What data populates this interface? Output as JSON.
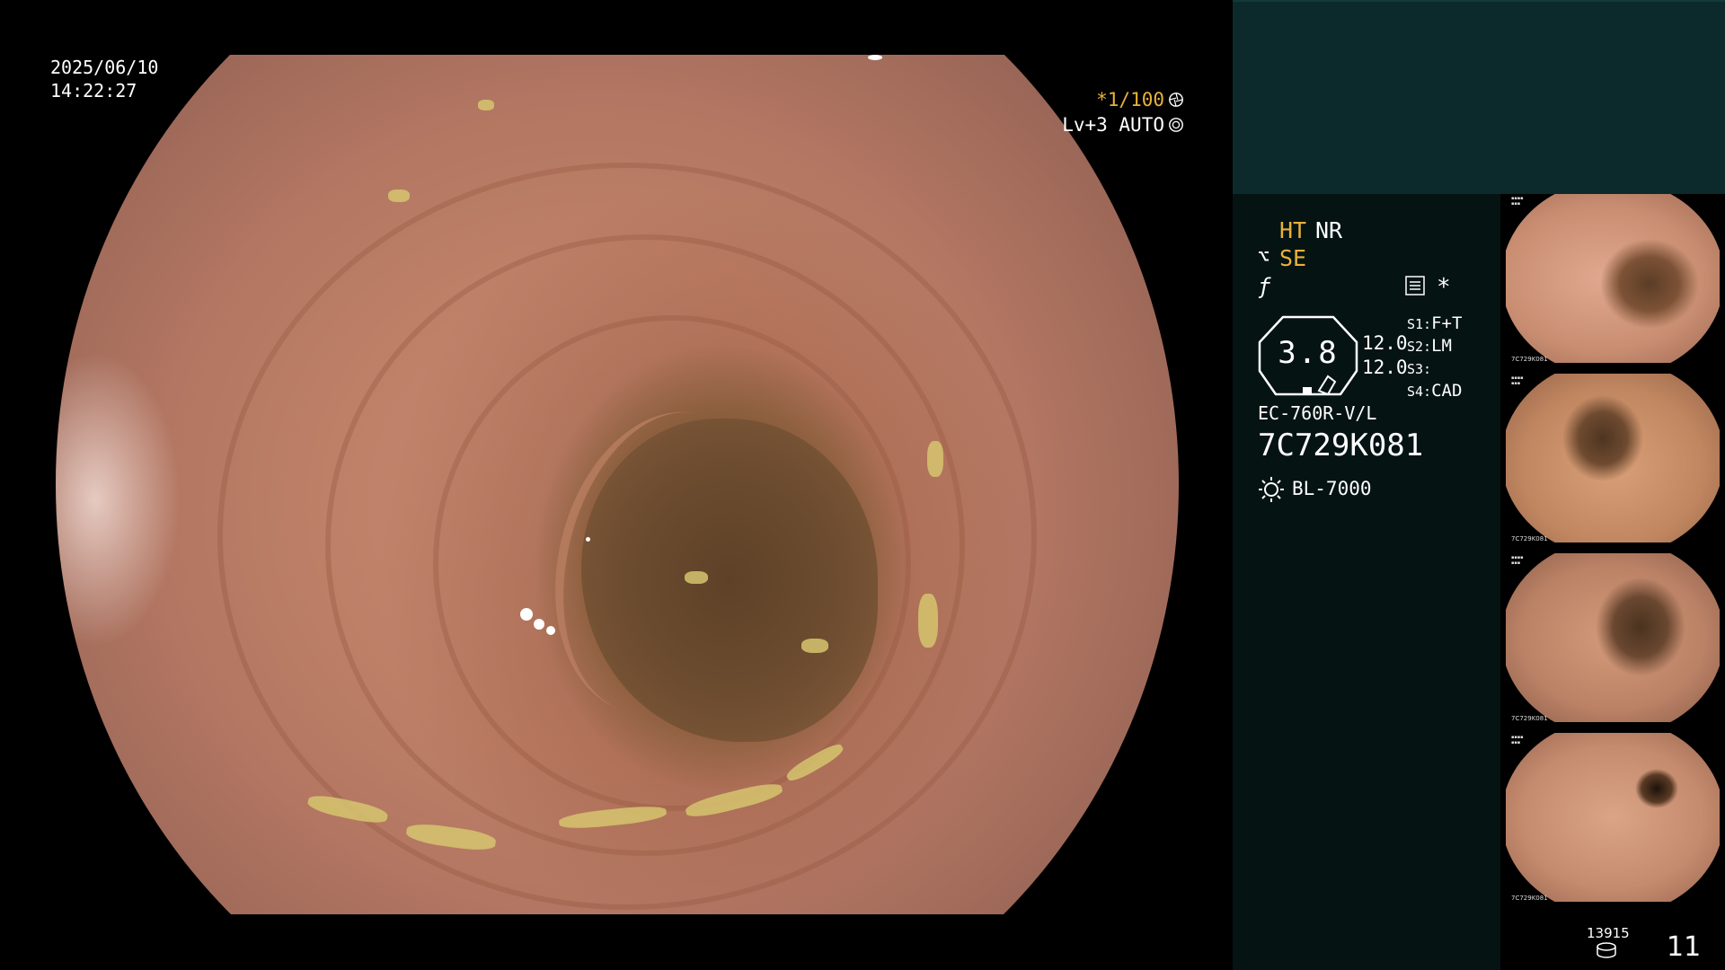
{
  "osd": {
    "date": "2025/06/10",
    "time": "14:22:27",
    "shutter": "*1/100",
    "level": "Lv+3 AUTO",
    "shutter_icon": "aperture-icon",
    "auto_icon": "auto-iris-icon"
  },
  "settings": {
    "ht": "HT",
    "nr": "NR",
    "se_icon": "structure-enhance-icon",
    "se": "SE",
    "f_icon": "function-icon",
    "menu_icon": "menu-icon",
    "star": "*",
    "zoom": "3.8",
    "param1": "12.0",
    "param2": "12.0",
    "s1_key": "S1:",
    "s1_val": "F+T",
    "s2_key": "S2:",
    "s2_val": "LM",
    "s3_key": "S3:",
    "s3_val": "",
    "s4_key": "S4:",
    "s4_val": "CAD"
  },
  "scope": {
    "model": "EC-760R-V/L",
    "serial": "7C729K081",
    "light_icon": "light-source-icon",
    "light_source": "BL-7000"
  },
  "thumbnails": [
    {
      "caption": "7C729K081"
    },
    {
      "caption": "7C729K081"
    },
    {
      "caption": "7C729K081"
    },
    {
      "caption": "7C729K081"
    }
  ],
  "storage": {
    "remaining": "13915",
    "icon": "storage-disk-icon",
    "captured_count": "11"
  },
  "colors": {
    "accent_amber": "#e8b23a",
    "panel_header": "#0c2a2b",
    "panel_body": "#061313"
  }
}
